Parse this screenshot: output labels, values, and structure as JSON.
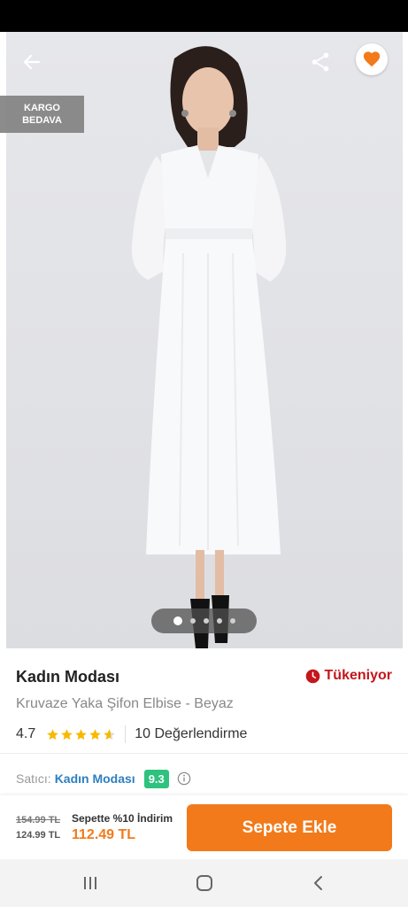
{
  "badges": {
    "cargo_line1": "KARGO",
    "cargo_line2": "BEDAVA"
  },
  "gallery": {
    "image_count": 5,
    "active_index": 0
  },
  "product": {
    "brand": "Kadın Modası",
    "stock_status": "Tükeniyor",
    "name": "Kruvaze Yaka Şifon Elbise - Beyaz",
    "rating": "4.7",
    "rating_stars": 4.7,
    "review_count": "10 Değerlendirme"
  },
  "seller": {
    "label": "Satıcı:",
    "name": "Kadın Modası",
    "score": "9.3"
  },
  "pricing": {
    "old_price": "154.99 TL",
    "price": "124.99 TL",
    "promo": "Sepette %10 İndirim",
    "final_price": "112.49 TL",
    "add_to_cart": "Sepete Ekle"
  },
  "icons": {
    "back": "back-arrow-icon",
    "share": "share-icon",
    "favorite": "heart-icon",
    "stock": "clock-icon",
    "info": "info-icon",
    "nav_recents": "recents-icon",
    "nav_home": "home-icon",
    "nav_back": "nav-back-icon"
  },
  "colors": {
    "accent": "#f27a1a",
    "stock_red": "#c4161c",
    "seller_blue": "#2d7fc1",
    "score_green": "#2ec27e",
    "star_yellow": "#f6b900"
  }
}
